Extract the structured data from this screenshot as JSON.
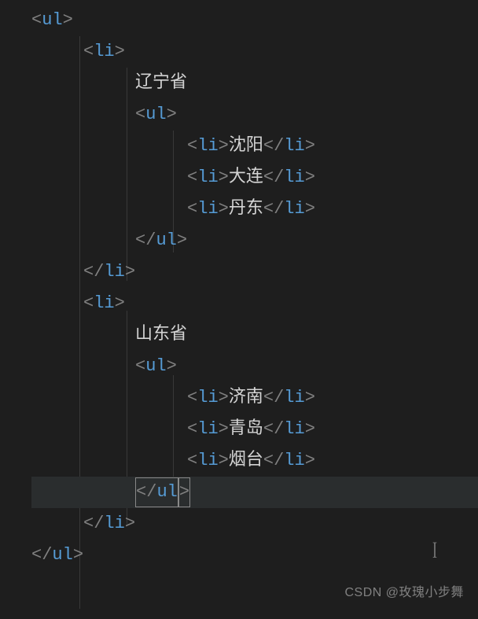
{
  "code": {
    "tags": {
      "ul_open": {
        "b1": "<",
        "name": "ul",
        "b2": ">"
      },
      "ul_close": {
        "b1": "</",
        "name": "ul",
        "b2": ">"
      },
      "li_open": {
        "b1": "<",
        "name": "li",
        "b2": ">"
      },
      "li_close": {
        "b1": "</",
        "name": "li",
        "b2": ">"
      }
    },
    "indent": {
      "i0": "",
      "i1": "     ",
      "i2": "          ",
      "i3": "               "
    },
    "texts": {
      "province1": "辽宁省",
      "p1_city1": "沈阳",
      "p1_city2": "大连",
      "p1_city3": "丹东",
      "province2": "山东省",
      "p2_city1": "济南",
      "p2_city2": "青岛",
      "p2_city3": "烟台"
    }
  },
  "watermark": "CSDN @玫瑰小步舞"
}
